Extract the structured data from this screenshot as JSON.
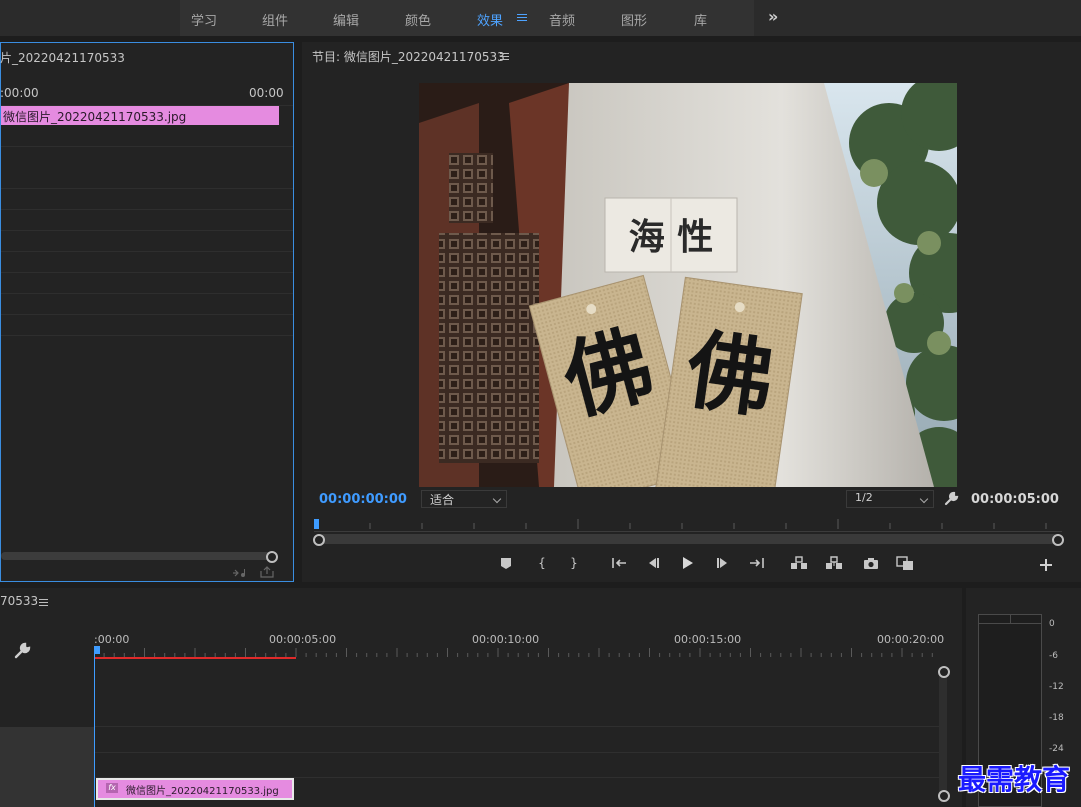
{
  "workspace": {
    "tabs": [
      "学习",
      "组件",
      "编辑",
      "颜色",
      "效果",
      "音频",
      "图形",
      "库"
    ],
    "active": "效果",
    "more": "»"
  },
  "source": {
    "title": "片_20220421170533",
    "timecode_start": ":00:00",
    "timecode_end": "00:00",
    "clip_name": "微信图片_20220421170533.jpg",
    "icons": [
      "audio-drag-icon",
      "export-icon"
    ]
  },
  "program": {
    "title": "节目: 微信图片_20220421170533",
    "timecode_current": "00:00:00:00",
    "timecode_duration": "00:00:05:00",
    "fit": "适合",
    "resolution": "1/2",
    "controls": [
      "add-marker",
      "mark-in",
      "mark-out",
      "go-to-in",
      "step-back",
      "play",
      "step-forward",
      "go-to-out",
      "lift",
      "extract",
      "export-frame",
      "compare-view",
      "add-button"
    ]
  },
  "photo": {
    "sign_text": "海 性",
    "card_left_text": "佛",
    "card_right_text": "佛"
  },
  "timeline": {
    "title": "70533",
    "ruler_labels": [
      ":00:00",
      "00:00:05:00",
      "00:00:10:00",
      "00:00:15:00",
      "00:00:20:00"
    ],
    "clip_name": "微信图片_20220421170533.jpg",
    "fx_label": "fx"
  },
  "meter": {
    "ticks": [
      "0",
      "-6",
      "-12",
      "-18",
      "-24"
    ]
  },
  "watermark": "最需教育",
  "colors": {
    "accent": "#3e9cff",
    "clip": "#e58be0",
    "work_area": "#e02a2a"
  }
}
